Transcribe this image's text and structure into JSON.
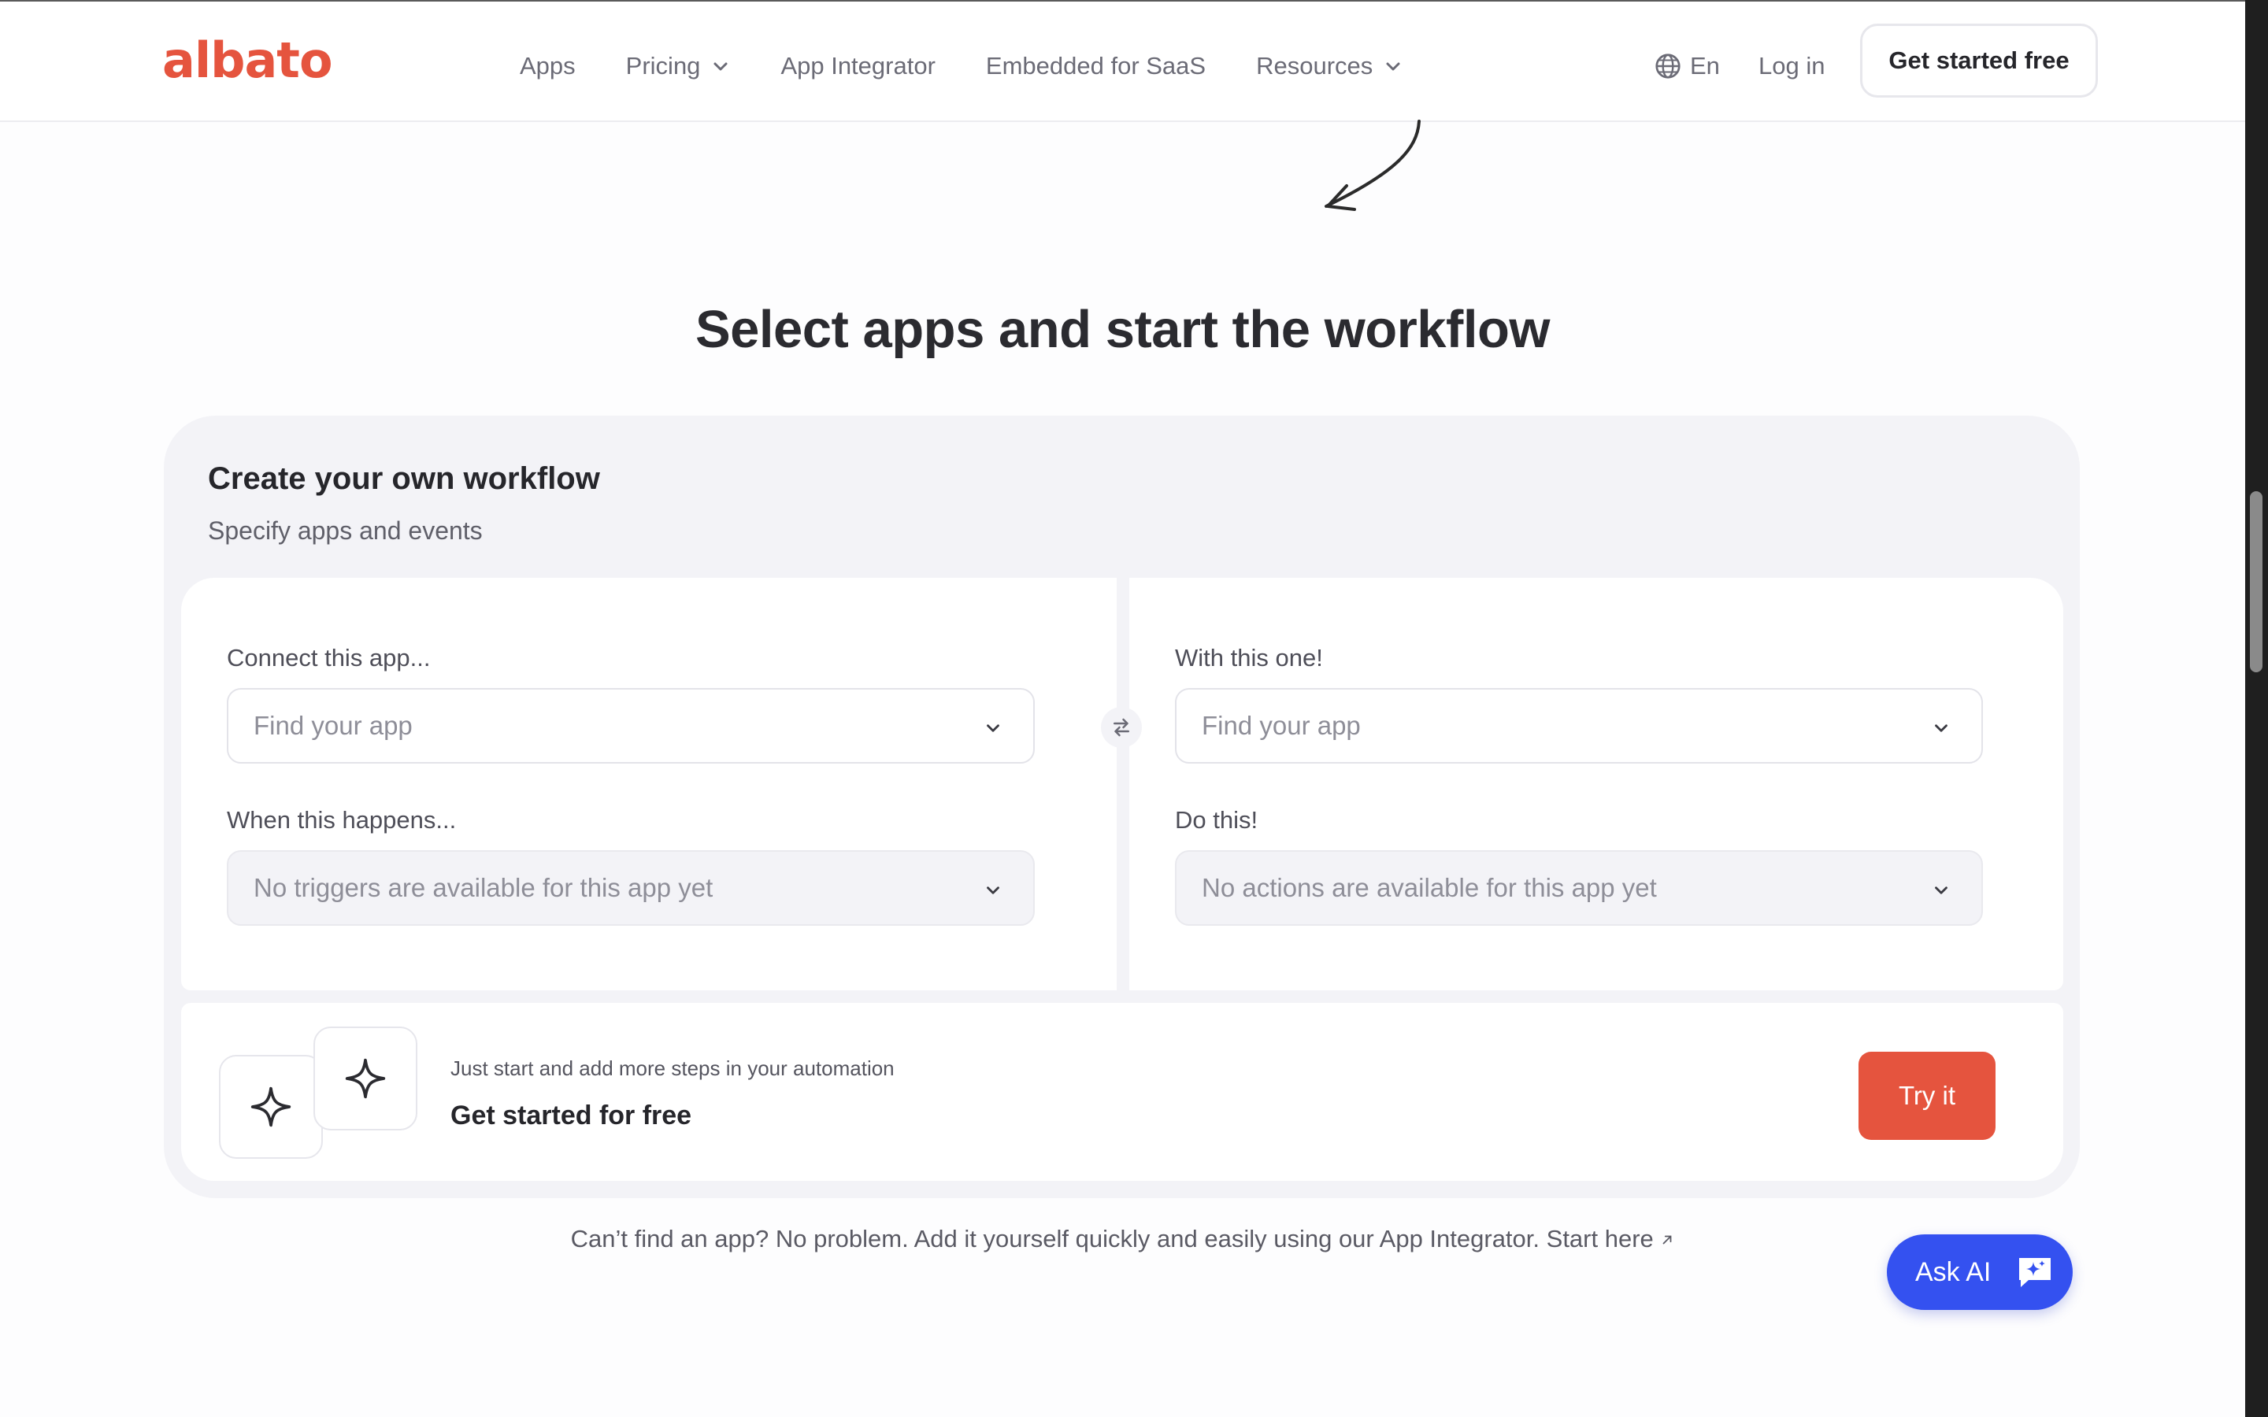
{
  "header": {
    "logo_text": "albato",
    "nav": [
      {
        "label": "Apps",
        "has_dropdown": false
      },
      {
        "label": "Pricing",
        "has_dropdown": true
      },
      {
        "label": "App Integrator",
        "has_dropdown": false
      },
      {
        "label": "Embedded for SaaS",
        "has_dropdown": false
      },
      {
        "label": "Resources",
        "has_dropdown": true
      }
    ],
    "language": "En",
    "login": "Log in",
    "cta": "Get started free"
  },
  "headline": "Select apps and start the workflow",
  "workflow": {
    "title": "Create your own workflow",
    "subtitle": "Specify apps and events",
    "left": {
      "app_label": "Connect this app...",
      "app_placeholder": "Find your app",
      "event_label": "When this happens...",
      "event_placeholder": "No triggers are available for this app yet"
    },
    "right": {
      "app_label": "With this one!",
      "app_placeholder": "Find your app",
      "event_label": "Do this!",
      "event_placeholder": "No actions are available for this app yet"
    },
    "footer": {
      "small_text": "Just start and add more steps in your automation",
      "big_text": "Get started for free",
      "button": "Try it"
    }
  },
  "bottom_note": {
    "text": "Can’t find an app? No problem. Add it yourself quickly and easily using our App Integrator.",
    "link": "Start here"
  },
  "ask_ai": "Ask AI",
  "colors": {
    "brand": "#e5543e",
    "ask_ai": "#3451f0",
    "card_bg": "#f3f3f7"
  }
}
